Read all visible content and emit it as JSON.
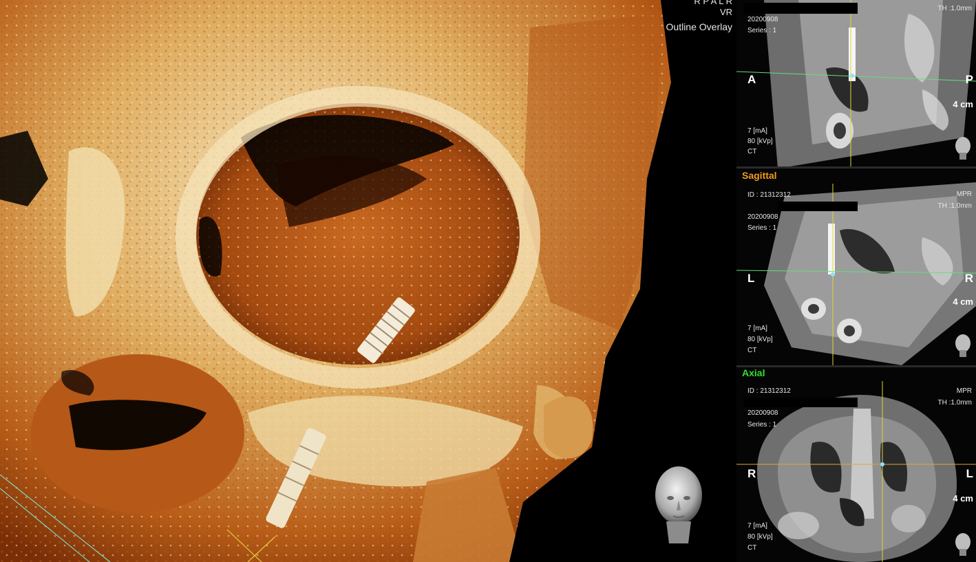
{
  "vr": {
    "orientation_letters": "R P A L R",
    "mode": "VR",
    "overlay_label": "Outline Overlay"
  },
  "panes": {
    "coronal": {
      "id_line": "",
      "date": "20200908",
      "series": "Series : 1",
      "thickness": "TH :1.0mm",
      "left_label": "A",
      "right_label": "P",
      "scale": "4 cm",
      "ma": "7 [mA]",
      "kvp": "80 [kVp]",
      "modality": "CT"
    },
    "sagittal": {
      "title": "Sagittal",
      "title_color": "#f39a1e",
      "id_line": "ID : 21312312",
      "mode": "MPR",
      "thickness": "TH :1.0mm",
      "date": "20200908",
      "series": "Series : 1",
      "left_label": "L",
      "right_label": "R",
      "scale": "4 cm",
      "ma": "7 [mA]",
      "kvp": "80 [kVp]",
      "modality": "CT"
    },
    "axial": {
      "title": "Axial",
      "title_color": "#2fe02f",
      "id_line": "ID : 21312312",
      "mode": "MPR",
      "thickness": "TH :1.0mm",
      "date": "20200908",
      "series": "Series : 1",
      "left_label": "R",
      "right_label": "L",
      "scale": "4 cm",
      "ma": "7 [mA]",
      "kvp": "80 [kVp]",
      "modality": "CT"
    }
  },
  "icons": {
    "orientation_head": "head-orientation-icon"
  },
  "colors": {
    "bone_light": "#f3e2b6",
    "bone_mid": "#d9a24e",
    "bone_dark": "#a34a10",
    "crosshair_green": "#5fe07a",
    "crosshair_yellow": "#e6d23a"
  }
}
